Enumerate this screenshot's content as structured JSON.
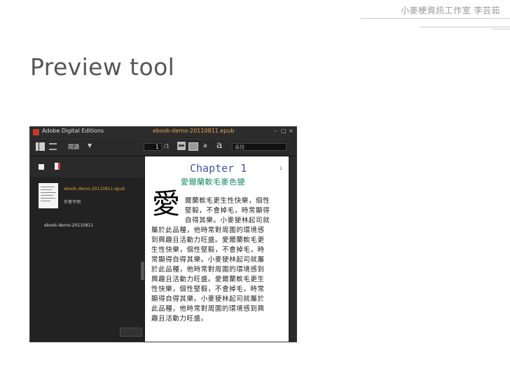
{
  "header": {
    "studio": "小麥梗資訊工作室 李芸茹"
  },
  "slide": {
    "title": "Preview tool"
  },
  "app": {
    "name": "Adobe Digital Editions",
    "file_title": "ebook-demo-20110811.epub",
    "toolbar": {
      "read_label": "閱讀",
      "page_current": "1",
      "page_total": "/1",
      "font_small": "a",
      "font_large": "a",
      "search_placeholder": "尋找"
    },
    "library": {
      "book_file": "ebook-demo-20110811.epub",
      "author": "作者不明",
      "book_name": "ebook-demo-20110811"
    },
    "page": {
      "chapter": "Chapter 1",
      "page_number": "1",
      "subtitle": "愛爾蘭軟毛麥色㹴",
      "drop_cap": "愛",
      "lines": [
        "爾蘭軟毛更生性快樂，個性",
        "堅毅，不會掉毛，時常顯得",
        "自得其樂。小麥㹴林起司就",
        "屬於此品種，他時常對周圍的環境感",
        "到興趣且活動力旺盛。愛爾蘭軟毛更",
        "生性快樂，個性堅毅，不會掉毛，時",
        "常顯得自得其樂。小麥㹴林起司就屬",
        "於此品種，他時常對周圍的環境感到",
        "興趣且活動力旺盛。愛爾蘭軟毛更生",
        "性快樂，個性堅毅，不會掉毛，時常",
        "顯得自得其樂。小麥㹴林起司就屬於",
        "此品種，他時常對周圍的環境感到興",
        "趣且活動力旺盛。"
      ]
    }
  }
}
